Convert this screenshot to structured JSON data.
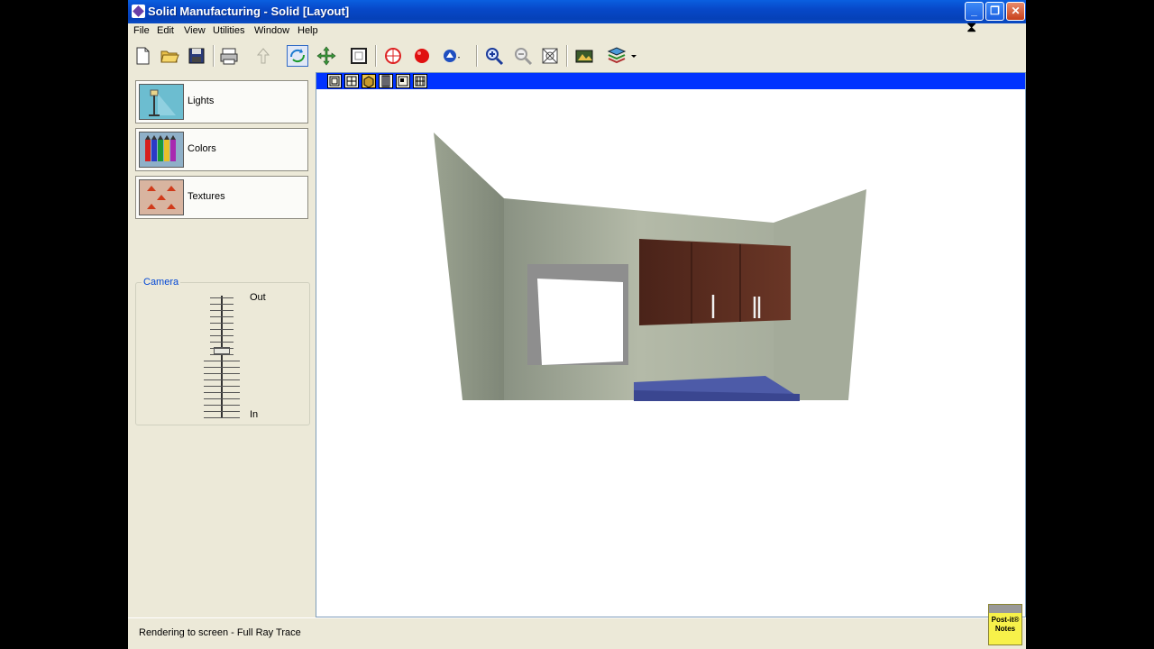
{
  "window": {
    "title": "Solid Manufacturing - Solid [Layout]"
  },
  "menu": [
    "File",
    "Edit",
    "View",
    "Utilities",
    "Window",
    "Help"
  ],
  "toolbar": {
    "icons": [
      "new-file-icon",
      "open-folder-icon",
      "save-icon",
      "print-icon",
      "up-arrow-icon",
      "rotate-view-icon",
      "pan-icon",
      "fit-frame-icon",
      "target-icon",
      "record-icon",
      "render-icon",
      "zoom-in-icon",
      "zoom-out-icon",
      "zoom-extents-icon",
      "camera-icon",
      "layers-icon"
    ]
  },
  "sidebar": {
    "buttons": [
      {
        "label": "Lights",
        "icon": "lamp-icon"
      },
      {
        "label": "Colors",
        "icon": "crayons-icon"
      },
      {
        "label": "Textures",
        "icon": "texture-tiles-icon"
      }
    ],
    "camera": {
      "title": "Camera",
      "out_label": "Out",
      "in_label": "In",
      "zoom_level": 0.48
    }
  },
  "view_tabs": [
    "floor-plan-tab-icon",
    "elevation-tab-icon",
    "3d-solid-tab-icon",
    "cabinet-list-tab-icon",
    "wall-view-tab-icon",
    "grid-view-tab-icon"
  ],
  "status": {
    "text": "Rendering to screen - Full Ray Trace"
  },
  "postit": {
    "line1": "Post-it®",
    "line2": "Notes"
  },
  "colors": {
    "title_bar": "#0a5fe0",
    "view_tab_bar": "#0033ff",
    "cabinet": "#5c2f22",
    "wall": "#a7ae9d",
    "countertop": "#4d5ba8"
  }
}
